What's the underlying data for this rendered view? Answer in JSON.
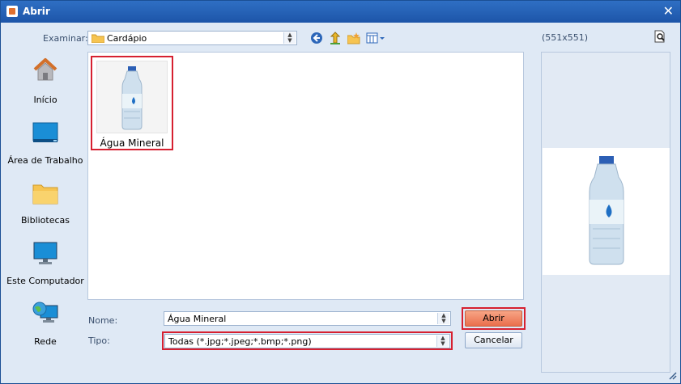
{
  "window": {
    "title": "Abrir",
    "close_glyph": "✕"
  },
  "toolbar": {
    "look_in_label": "Examinar:",
    "look_in_value": "Cardápio",
    "buttons": [
      "back-icon",
      "up-folder-icon",
      "new-folder-icon",
      "view-menu-icon"
    ]
  },
  "places": [
    {
      "label": "Início",
      "icon": "home-icon"
    },
    {
      "label": "Área de Trabalho",
      "icon": "desktop-icon"
    },
    {
      "label": "Bibliotecas",
      "icon": "libraries-folder-icon"
    },
    {
      "label": "Este Computador",
      "icon": "computer-monitor-icon"
    },
    {
      "label": "Rede",
      "icon": "network-globe-icon"
    }
  ],
  "files": [
    {
      "name": "Água Mineral",
      "selected": true,
      "thumbnail": "water-bottle-image"
    }
  ],
  "form": {
    "name_label": "Nome:",
    "name_value": "Água Mineral",
    "type_label": "Tipo:",
    "type_value": "Todas (*.jpg;*.jpeg;*.bmp;*.png)"
  },
  "buttons": {
    "open": "Abrir",
    "cancel": "Cancelar"
  },
  "preview": {
    "dimensions": "(551x551)"
  },
  "colors": {
    "accent_red": "#d62030",
    "title_bar": "#2560b4",
    "primary_button": "#ee7a56"
  }
}
